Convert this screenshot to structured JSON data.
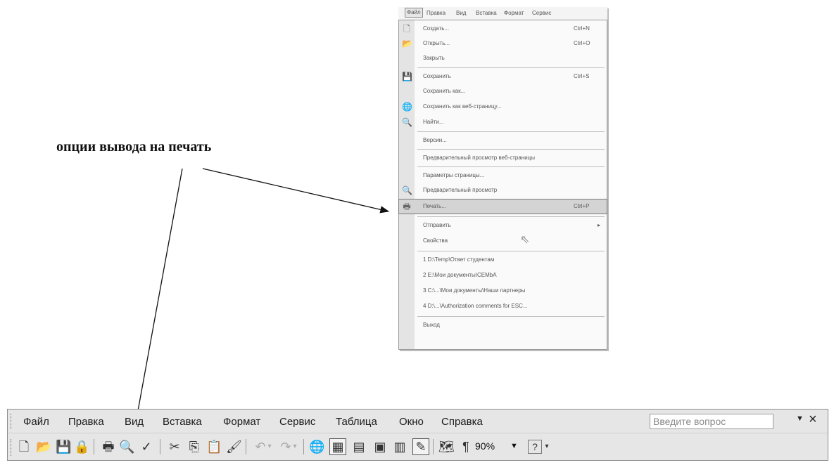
{
  "annotation": {
    "caption": "опции вывода на печать"
  },
  "menu": {
    "menubar": [
      "Файл",
      "Правка",
      "Вид",
      "Вставка",
      "Формат",
      "Сервис"
    ],
    "items": [
      {
        "label": "Создать...",
        "shortcut": "Ctrl+N",
        "icon": "new-document-icon"
      },
      {
        "label": "Открыть...",
        "shortcut": "Ctrl+O",
        "icon": "open-folder-icon"
      },
      {
        "label": "Закрыть",
        "shortcut": "",
        "icon": ""
      },
      {
        "label": "Сохранить",
        "shortcut": "Ctrl+S",
        "icon": "save-icon"
      },
      {
        "label": "Сохранить как...",
        "shortcut": "",
        "icon": ""
      },
      {
        "label": "Сохранить как веб-страницу...",
        "shortcut": "",
        "icon": "web-save-icon"
      },
      {
        "label": "Найти...",
        "shortcut": "",
        "icon": "find-icon"
      },
      {
        "label": "Версии...",
        "shortcut": "",
        "icon": ""
      },
      {
        "label": "Предварительный просмотр веб-страницы",
        "shortcut": "",
        "icon": ""
      },
      {
        "label": "Параметры страницы...",
        "shortcut": "",
        "icon": ""
      },
      {
        "label": "Предварительный просмотр",
        "shortcut": "",
        "icon": "print-preview-icon"
      },
      {
        "label": "Печать...",
        "shortcut": "Ctrl+P",
        "icon": "printer-icon"
      },
      {
        "label": "Отправить",
        "shortcut": "▸",
        "icon": ""
      },
      {
        "label": "Свойства",
        "shortcut": "",
        "icon": ""
      },
      {
        "label": "1 D:\\Temp\\Ответ студентам",
        "shortcut": "",
        "icon": ""
      },
      {
        "label": "2 E:\\Мои документы\\CEMbA",
        "shortcut": "",
        "icon": ""
      },
      {
        "label": "3 C:\\...\\Мои документы\\Наши партнеры",
        "shortcut": "",
        "icon": ""
      },
      {
        "label": "4 D:\\...\\Authorization comments for ESC...",
        "shortcut": "",
        "icon": ""
      },
      {
        "label": "Выход",
        "shortcut": "",
        "icon": ""
      }
    ]
  },
  "toolbar": {
    "menus": [
      "Файл",
      "Правка",
      "Вид",
      "Вставка",
      "Формат",
      "Сервис",
      "Таблица",
      "Окно",
      "Справка"
    ],
    "ask_placeholder": "Введите вопрос",
    "close": "×",
    "zoom": "90%",
    "buttons": [
      {
        "name": "new-icon",
        "glyph": "🗋"
      },
      {
        "name": "open-icon",
        "glyph": "📂"
      },
      {
        "name": "save-icon",
        "glyph": "💾"
      },
      {
        "name": "permission-icon",
        "glyph": "🔒"
      },
      {
        "name": "print-icon",
        "glyph": "🖶"
      },
      {
        "name": "print-preview-icon",
        "glyph": "🔍"
      },
      {
        "name": "spelling-icon",
        "glyph": "✓"
      },
      {
        "name": "cut-icon",
        "glyph": "✂"
      },
      {
        "name": "copy-icon",
        "glyph": "⎘"
      },
      {
        "name": "paste-icon",
        "glyph": "📋"
      },
      {
        "name": "format-painter-icon",
        "glyph": "🖌"
      },
      {
        "name": "undo-icon",
        "glyph": "↶"
      },
      {
        "name": "redo-icon",
        "glyph": "↷"
      },
      {
        "name": "hyperlink-icon",
        "glyph": "🌐"
      },
      {
        "name": "tables-borders-icon",
        "glyph": "▦"
      },
      {
        "name": "insert-table-icon",
        "glyph": "▤"
      },
      {
        "name": "insert-excel-icon",
        "glyph": "▣"
      },
      {
        "name": "columns-icon",
        "glyph": "▥"
      },
      {
        "name": "drawing-icon",
        "glyph": "✎"
      },
      {
        "name": "document-map-icon",
        "glyph": "🗺"
      },
      {
        "name": "pilcrow-icon",
        "glyph": "¶"
      },
      {
        "name": "help-icon",
        "glyph": "?"
      }
    ]
  }
}
